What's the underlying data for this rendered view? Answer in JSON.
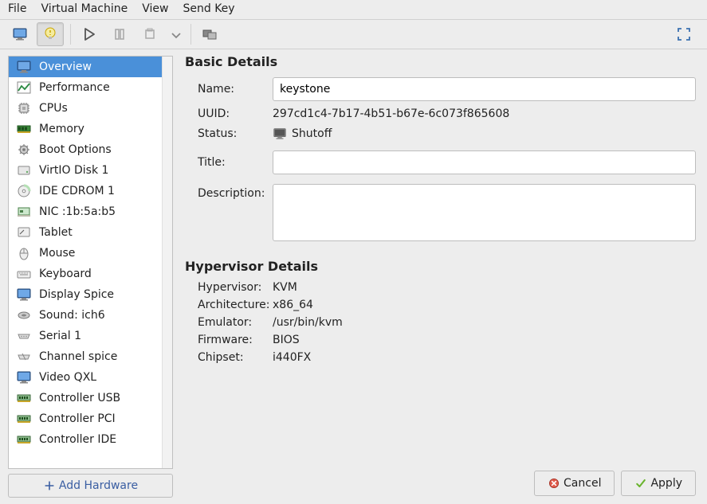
{
  "menubar": [
    "File",
    "Virtual Machine",
    "View",
    "Send Key"
  ],
  "sidebar": {
    "items": [
      {
        "label": "Overview"
      },
      {
        "label": "Performance"
      },
      {
        "label": "CPUs"
      },
      {
        "label": "Memory"
      },
      {
        "label": "Boot Options"
      },
      {
        "label": "VirtIO Disk 1"
      },
      {
        "label": "IDE CDROM 1"
      },
      {
        "label": "NIC :1b:5a:b5"
      },
      {
        "label": "Tablet"
      },
      {
        "label": "Mouse"
      },
      {
        "label": "Keyboard"
      },
      {
        "label": "Display Spice"
      },
      {
        "label": "Sound: ich6"
      },
      {
        "label": "Serial 1"
      },
      {
        "label": "Channel spice"
      },
      {
        "label": "Video QXL"
      },
      {
        "label": "Controller USB"
      },
      {
        "label": "Controller PCI"
      },
      {
        "label": "Controller IDE"
      }
    ],
    "add": "Add Hardware"
  },
  "basic": {
    "title": "Basic Details",
    "name_lbl": "Name:",
    "name_val": "keystone",
    "uuid_lbl": "UUID:",
    "uuid_val": "297cd1c4-7b17-4b51-b67e-6c073f865608",
    "status_lbl": "Status:",
    "status_val": "Shutoff",
    "title_lbl": "Title:",
    "title_val": "",
    "desc_lbl": "Description:",
    "desc_val": ""
  },
  "hv": {
    "title": "Hypervisor Details",
    "rows": [
      {
        "lbl": "Hypervisor:",
        "val": "KVM"
      },
      {
        "lbl": "Architecture:",
        "val": "x86_64"
      },
      {
        "lbl": "Emulator:",
        "val": "/usr/bin/kvm"
      },
      {
        "lbl": "Firmware:",
        "val": "BIOS"
      },
      {
        "lbl": "Chipset:",
        "val": "i440FX"
      }
    ]
  },
  "buttons": {
    "cancel": "Cancel",
    "apply": "Apply"
  }
}
